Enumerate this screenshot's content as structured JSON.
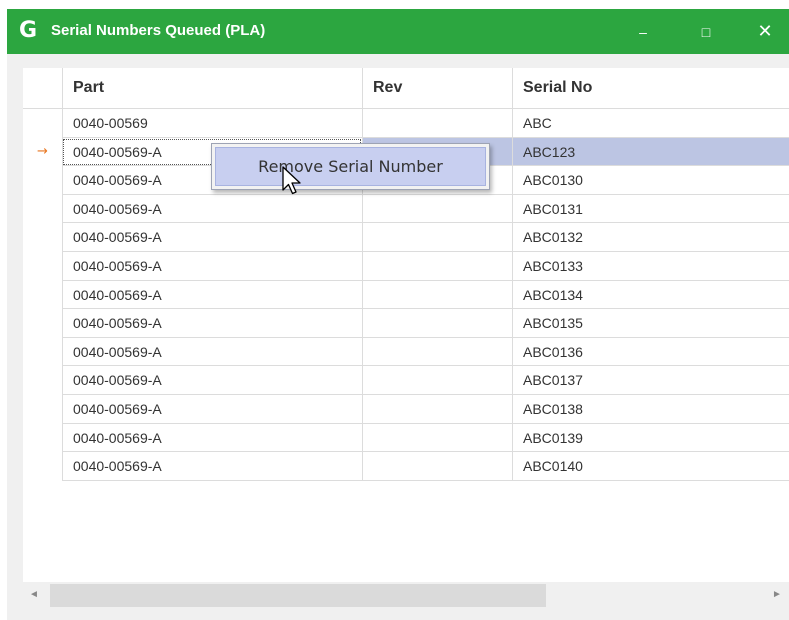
{
  "window": {
    "title": "Serial Numbers Queued (PLA)",
    "icon": "G",
    "minimize_glyph": "–",
    "maximize_glyph": "□",
    "close_glyph": "✕"
  },
  "grid": {
    "columns": [
      "Part",
      "Rev",
      "Serial No"
    ],
    "current_row_indicator": "→",
    "selected_row_index": 1,
    "rows": [
      {
        "part": "0040-00569",
        "rev": "",
        "serial": "ABC"
      },
      {
        "part": "0040-00569-A",
        "rev": "",
        "serial": "ABC123"
      },
      {
        "part": "0040-00569-A",
        "rev": "",
        "serial": "ABC0130"
      },
      {
        "part": "0040-00569-A",
        "rev": "",
        "serial": "ABC0131"
      },
      {
        "part": "0040-00569-A",
        "rev": "",
        "serial": "ABC0132"
      },
      {
        "part": "0040-00569-A",
        "rev": "",
        "serial": "ABC0133"
      },
      {
        "part": "0040-00569-A",
        "rev": "",
        "serial": "ABC0134"
      },
      {
        "part": "0040-00569-A",
        "rev": "",
        "serial": "ABC0135"
      },
      {
        "part": "0040-00569-A",
        "rev": "",
        "serial": "ABC0136"
      },
      {
        "part": "0040-00569-A",
        "rev": "",
        "serial": "ABC0137"
      },
      {
        "part": "0040-00569-A",
        "rev": "",
        "serial": "ABC0138"
      },
      {
        "part": "0040-00569-A",
        "rev": "",
        "serial": "ABC0139"
      },
      {
        "part": "0040-00569-A",
        "rev": "",
        "serial": "ABC0140"
      }
    ]
  },
  "context_menu": {
    "items": [
      "Remove Serial Number"
    ]
  },
  "scrollbar": {
    "left_arrow": "◄",
    "right_arrow": "►"
  },
  "colors": {
    "titlebar": "#2ca640",
    "selection": "#bcc5e3",
    "menu_highlight": "#c8cff0",
    "indicator": "#e87722"
  }
}
